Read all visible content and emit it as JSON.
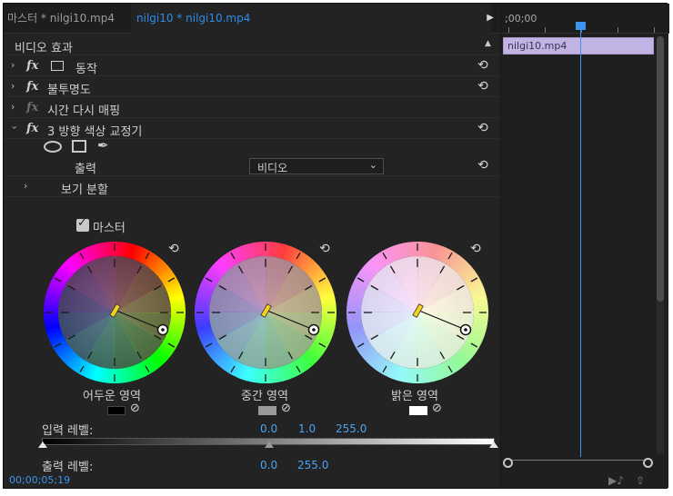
{
  "tabs": {
    "source_tab": "마스터 * nilgi10.mp4",
    "effect_controls_tab": "nilgi10 * nilgi10.mp4"
  },
  "section": {
    "title": "비디오 효과"
  },
  "effects": [
    {
      "label": "동작",
      "expanded": false,
      "enabled": true,
      "icon": "transform-icon"
    },
    {
      "label": "불투명도",
      "expanded": false,
      "enabled": true
    },
    {
      "label": "시간 다시 매핑",
      "expanded": false,
      "enabled": false
    },
    {
      "label": "3 방향 색상 교정기",
      "expanded": true,
      "enabled": true
    }
  ],
  "fx_text": "fx",
  "output": {
    "label": "출력",
    "value": "비디오"
  },
  "split_view": {
    "label": "보기 분할"
  },
  "master": {
    "label": "마스터",
    "checked": true
  },
  "wheels": [
    {
      "label": "어두운 영역",
      "swatch_color": "#000000",
      "bg_tint": "#000000"
    },
    {
      "label": "중간 영역",
      "swatch_color": "#9a9a9a",
      "bg_tint": "#7f7f7f"
    },
    {
      "label": "밝은 영역",
      "swatch_color": "#ffffff",
      "bg_tint": "#ffffff"
    }
  ],
  "input_levels": {
    "label": "입력 레벨:",
    "black": "0.0",
    "gamma": "1.0",
    "white": "255.0"
  },
  "output_levels": {
    "label": "출력 레벨:",
    "black": "0.0",
    "white": "255.0"
  },
  "timecode": "00;00;05;19",
  "timeline": {
    "ruler_text": ";00;00",
    "clip_label": "nilgi10.mp4",
    "clip_color": "#c1b3e3",
    "playhead_color": "#3b94ee"
  },
  "colors": {
    "accent": "#2d8ceb",
    "panel_bg": "#232323"
  }
}
